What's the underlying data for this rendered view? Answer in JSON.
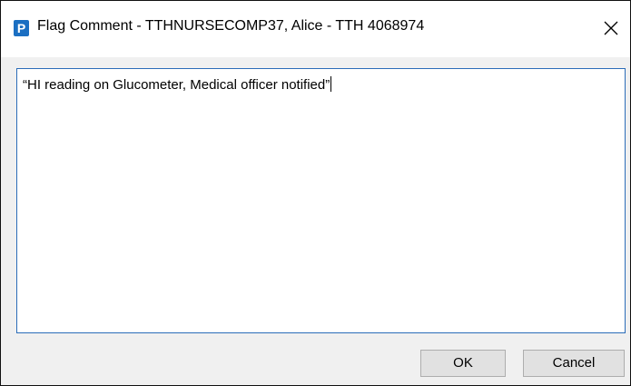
{
  "window": {
    "title": "Flag Comment - TTHNURSECOMP37, Alice - TTH 4068974",
    "app_icon_letter": "P",
    "app_icon_color": "#1b6fc2"
  },
  "comment": {
    "value": "“HI reading on Glucometer, Medical officer notified”"
  },
  "buttons": {
    "ok_label": "OK",
    "cancel_label": "Cancel"
  },
  "icons": {
    "app": "app-logo-icon",
    "close": "close-icon"
  }
}
